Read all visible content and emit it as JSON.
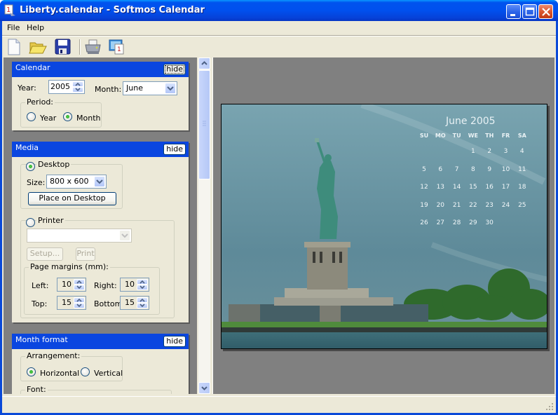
{
  "window": {
    "title": "Liberty.calendar - Softmos Calendar",
    "app_icon": "calendar-app-icon",
    "controls": [
      "minimize",
      "maximize",
      "close"
    ]
  },
  "menu": {
    "items": [
      {
        "label": "File"
      },
      {
        "label": "Help"
      }
    ]
  },
  "toolbar": {
    "buttons": [
      {
        "name": "new",
        "icon": "new-document-icon"
      },
      {
        "name": "open",
        "icon": "open-folder-icon"
      },
      {
        "name": "save",
        "icon": "save-disk-icon"
      },
      {
        "name": "print",
        "icon": "printer-icon"
      },
      {
        "name": "desktop",
        "icon": "place-on-desktop-icon"
      }
    ]
  },
  "panels": {
    "calendar": {
      "title": "Calendar",
      "hide_label": "hide",
      "year_label": "Year:",
      "year_value": "2005",
      "month_label": "Month:",
      "month_value": "June",
      "period_legend": "Period:",
      "period_options": [
        {
          "label": "Year",
          "checked": false
        },
        {
          "label": "Month",
          "checked": true
        }
      ]
    },
    "media": {
      "title": "Media",
      "hide_label": "hide",
      "desktop_label": "Desktop",
      "desktop_checked": true,
      "size_label": "Size:",
      "size_value": "800 x 600",
      "place_button": "Place on Desktop",
      "printer_label": "Printer",
      "printer_checked": false,
      "printer_value": "",
      "setup_button": "Setup...",
      "print_button": "Print",
      "margins_legend": "Page margins (mm):",
      "margins": {
        "left_label": "Left:",
        "left_value": "10",
        "right_label": "Right:",
        "right_value": "10",
        "top_label": "Top:",
        "top_value": "15",
        "bottom_label": "Bottom:",
        "bottom_value": "15"
      }
    },
    "month_format": {
      "title": "Month format",
      "hide_label": "hide",
      "arrangement_legend": "Arrangement:",
      "arrangement_options": [
        {
          "label": "Horizontal",
          "checked": true
        },
        {
          "label": "Vertical",
          "checked": false
        }
      ],
      "font_legend": "Font:"
    }
  },
  "preview": {
    "calendar_title": "June 2005",
    "weekdays": [
      "SU",
      "MO",
      "TU",
      "WE",
      "TH",
      "FR",
      "SA"
    ],
    "first_weekday_index": 3,
    "days_in_month": 30,
    "colors": {
      "sky_top": "#6f9aa7",
      "sky_bottom": "#5b8796",
      "statue": "#3f8a7a",
      "grass": "#4d8a3a",
      "water": "#3d6e7a"
    }
  },
  "status": {
    "text": ""
  }
}
